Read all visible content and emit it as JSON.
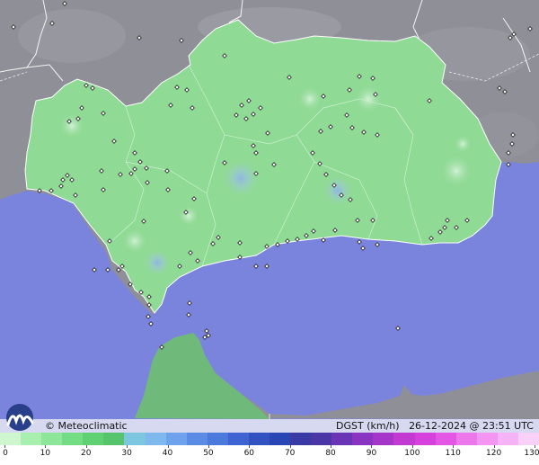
{
  "brand": {
    "name": "© Meteoclimatic",
    "logo_icon": "meteoclimatic-m-logo-icon"
  },
  "legend": {
    "title": "DGST (km/h)",
    "timestamp": "26-12-2024 @ 23:51 UTC",
    "ticks": [
      "0",
      "10",
      "20",
      "30",
      "40",
      "50",
      "60",
      "70",
      "80",
      "90",
      "100",
      "110",
      "120",
      "130"
    ],
    "colors": [
      "#cef7d0",
      "#a8efb0",
      "#8ee69a",
      "#74dc84",
      "#5fd073",
      "#56c46c",
      "#7cc6e0",
      "#7fb8ec",
      "#6fa2ec",
      "#5a8ce6",
      "#4c79dc",
      "#3f63d2",
      "#3252c2",
      "#2a46b4",
      "#3a3aa6",
      "#4a36a4",
      "#6a34b6",
      "#8a34c4",
      "#a636ca",
      "#c23ad2",
      "#d640dc",
      "#e456e4",
      "#ec78ec",
      "#f296f2",
      "#f6b4f6",
      "#f8d0f8"
    ]
  },
  "map": {
    "sea_color": "#7b84dc",
    "land_color": "#8f8f97",
    "andalusia_color": "#8fda94",
    "africa_color": "#6fba7a"
  }
}
